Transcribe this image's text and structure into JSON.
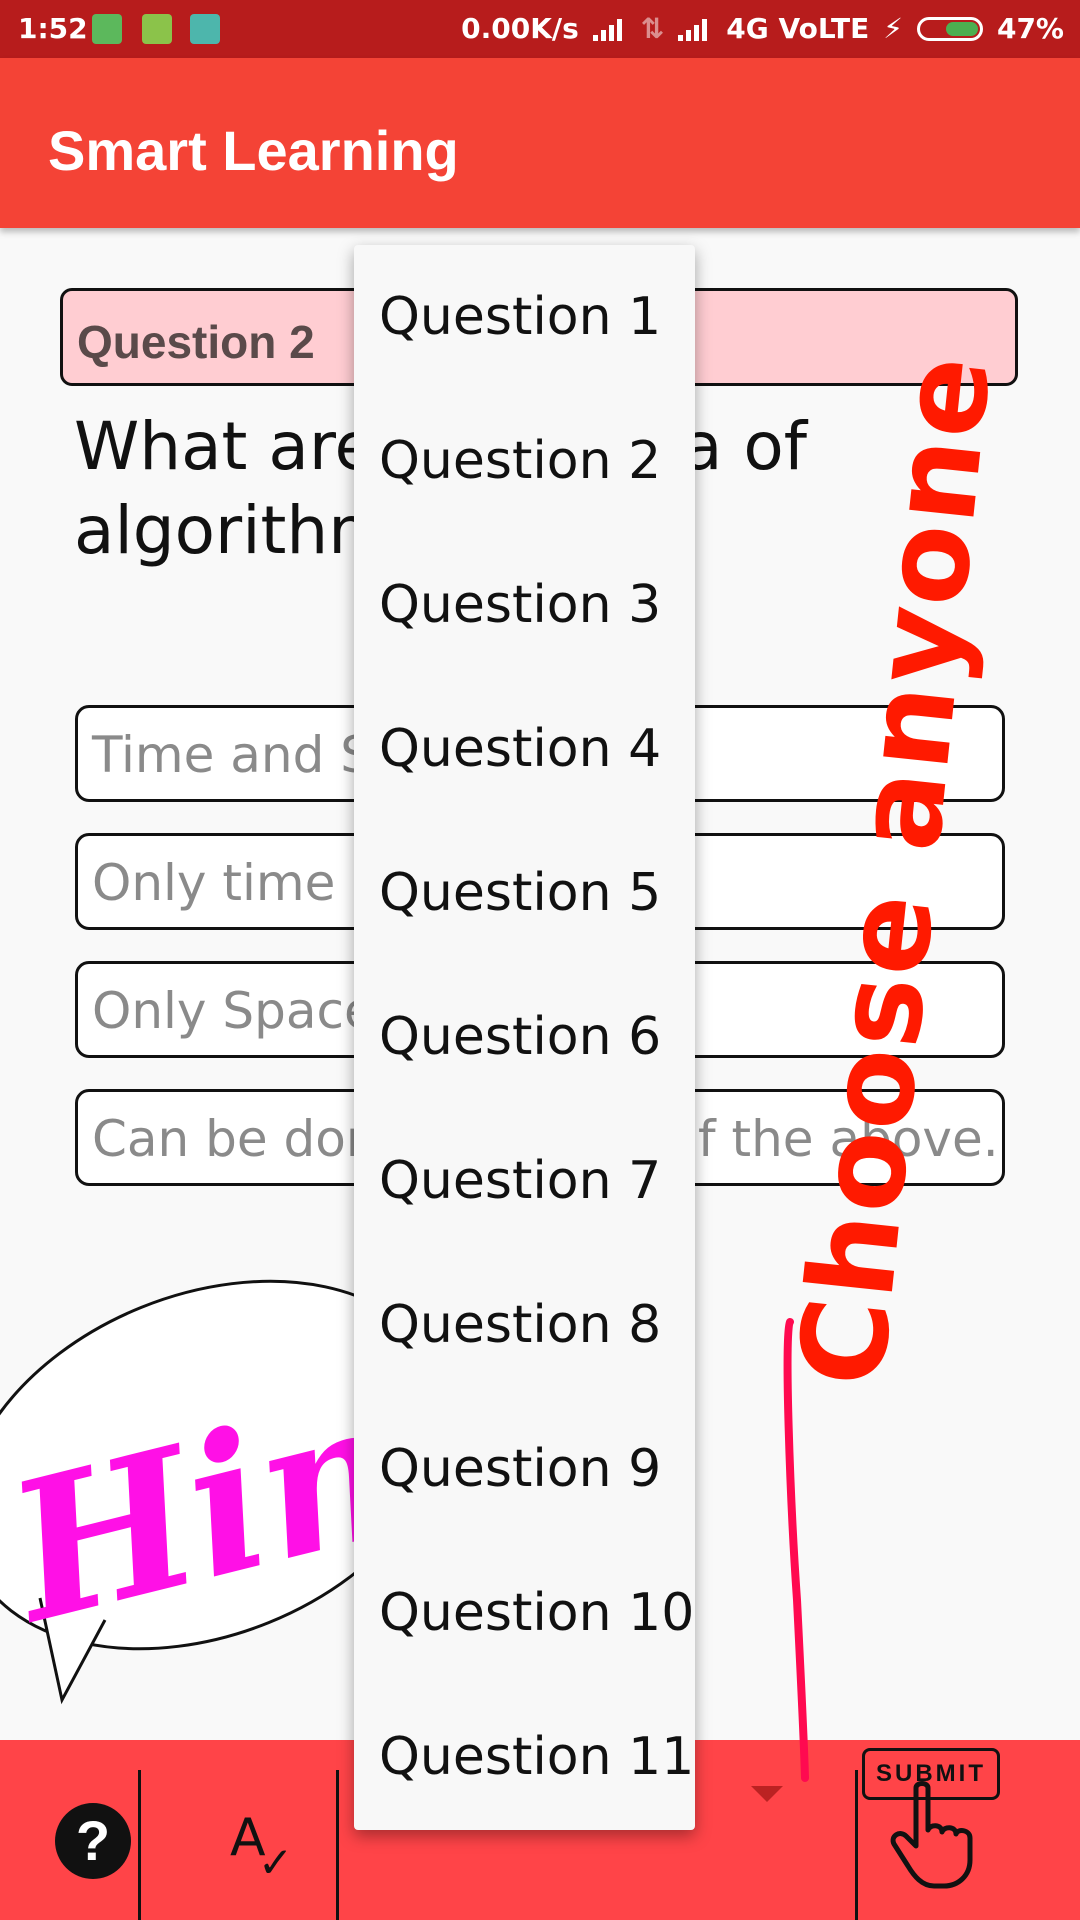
{
  "status_bar": {
    "time": "1:52",
    "network_speed": "0.00K/s",
    "network_type": "4G VoLTE",
    "battery": "47%",
    "colors": {
      "bar": "#b71c1c",
      "battery_fill": "#4caf50"
    }
  },
  "app_bar": {
    "title": "Smart Learning",
    "color": "#f44336"
  },
  "question": {
    "header": "Question 2",
    "text_line1": "What are",
    "text_line1_end": "a of",
    "text_line2": "algorithm"
  },
  "options": [
    {
      "text": "Time and Sp"
    },
    {
      "text": "Only time"
    },
    {
      "text": "Only Space"
    },
    {
      "text": "Can be done",
      "text_end": "f the above."
    }
  ],
  "dropdown": {
    "items": [
      "Question 1",
      "Question 2",
      "Question 3",
      "Question 4",
      "Question 5",
      "Question 6",
      "Question 7",
      "Question 8",
      "Question 9",
      "Question 10",
      "Question 11"
    ]
  },
  "bottom_bar": {
    "help_icon": "help-icon",
    "spellcheck_icon": "spellcheck-icon",
    "submit_label": "SUBMIT",
    "color": "#ff4448"
  },
  "annotations": {
    "hint": "Hint",
    "choose": "Choose anyone",
    "hint_color": "#ff10e6",
    "choose_color": "#ff1a00"
  }
}
